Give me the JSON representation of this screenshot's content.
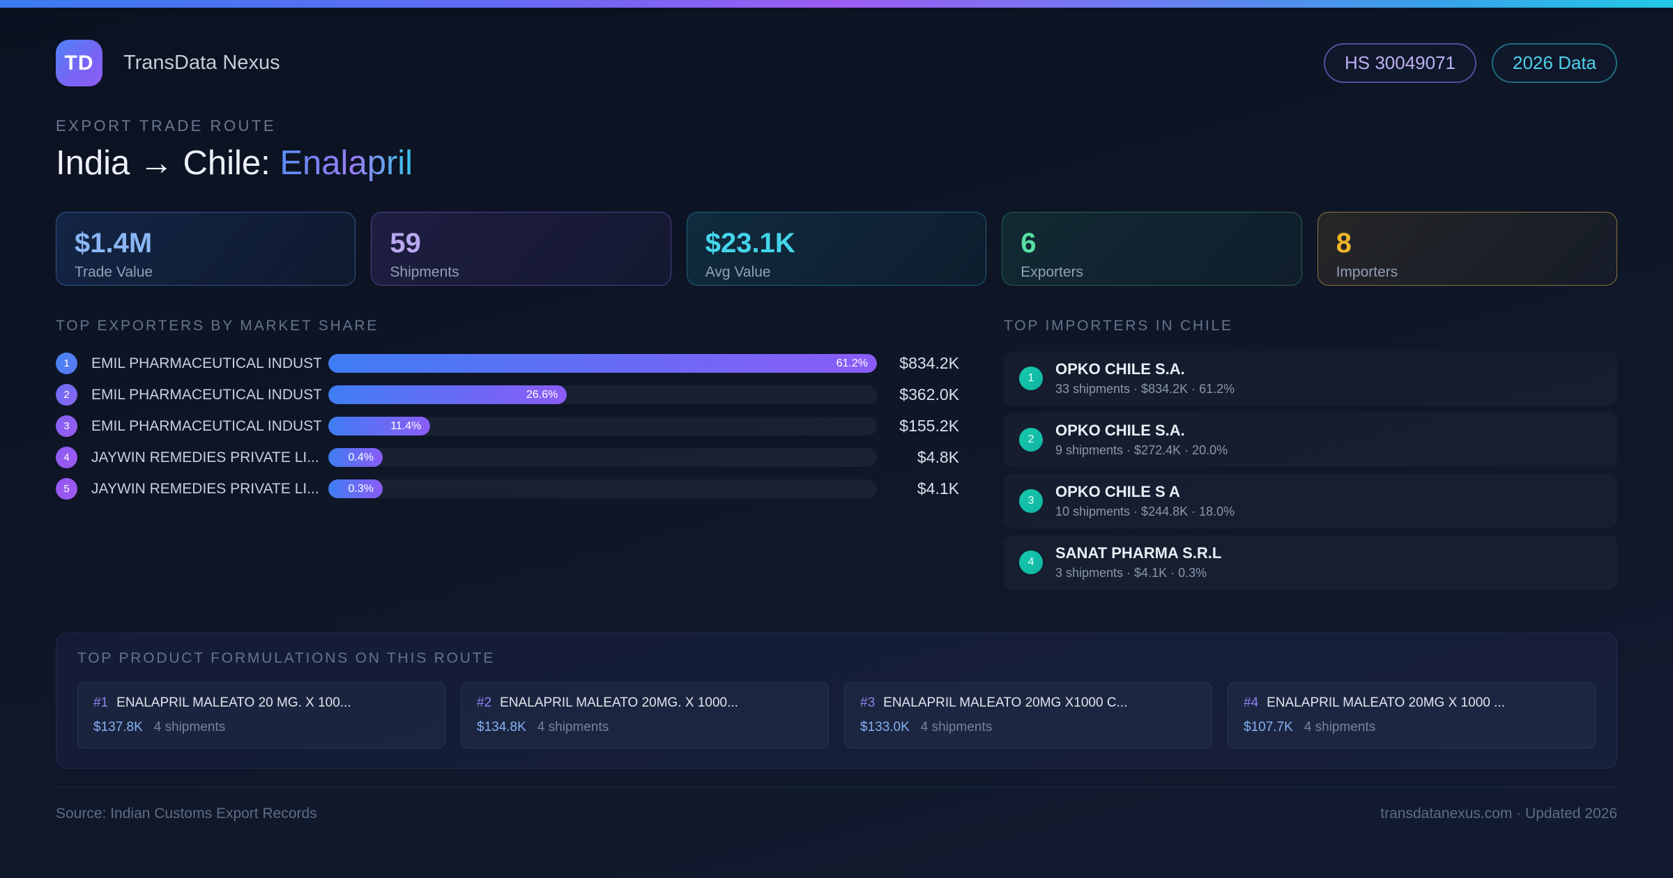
{
  "app": {
    "logo_text": "TD",
    "name": "TransData Nexus",
    "hs_badge": "HS 30049071",
    "year_badge": "2026 Data"
  },
  "header": {
    "eyebrow": "EXPORT TRADE ROUTE",
    "title_route": "India → Chile: ",
    "title_product": "Enalapril"
  },
  "stats": [
    {
      "value": "$1.4M",
      "label": "Trade Value",
      "color": "#8ab6f5"
    },
    {
      "value": "59",
      "label": "Shipments",
      "color": "#b9a7f0"
    },
    {
      "value": "$23.1K",
      "label": "Avg Value",
      "color": "#45d4ec"
    },
    {
      "value": "6",
      "label": "Exporters",
      "color": "#57dfa3"
    },
    {
      "value": "8",
      "label": "Importers",
      "color": "#f0b429"
    }
  ],
  "exporters": {
    "heading": "TOP EXPORTERS BY MARKET SHARE",
    "rows": [
      {
        "rank": "1",
        "name": "EMIL PHARMACEUTICAL INDUST...",
        "share_label": "61.2%",
        "bar_width": "100%",
        "value": "$834.2K"
      },
      {
        "rank": "2",
        "name": "EMIL PHARMACEUTICAL INDUST...",
        "share_label": "26.6%",
        "bar_width": "43.5%",
        "value": "$362.0K"
      },
      {
        "rank": "3",
        "name": "EMIL PHARMACEUTICAL INDUST...",
        "share_label": "11.4%",
        "bar_width": "18.6%",
        "value": "$155.2K"
      },
      {
        "rank": "4",
        "name": "JAYWIN REMEDIES PRIVATE LI...",
        "share_label": "0.4%",
        "bar_width": "0.7%",
        "value": "$4.8K"
      },
      {
        "rank": "5",
        "name": "JAYWIN REMEDIES PRIVATE LI...",
        "share_label": "0.3%",
        "bar_width": "0.5%",
        "value": "$4.1K"
      }
    ]
  },
  "importers": {
    "heading": "TOP IMPORTERS IN CHILE",
    "rows": [
      {
        "rank": "1",
        "name": "OPKO CHILE S.A.",
        "meta": "33 shipments · $834.2K · 61.2%"
      },
      {
        "rank": "2",
        "name": "OPKO CHILE S.A.",
        "meta": "9 shipments · $272.4K · 20.0%"
      },
      {
        "rank": "3",
        "name": "OPKO CHILE S A",
        "meta": "10 shipments · $244.8K · 18.0%"
      },
      {
        "rank": "4",
        "name": "SANAT PHARMA S.R.L",
        "meta": "3 shipments · $4.1K · 0.3%"
      }
    ]
  },
  "products": {
    "heading": "TOP PRODUCT FORMULATIONS ON THIS ROUTE",
    "cards": [
      {
        "rank": "#1",
        "name": "ENALAPRIL MALEATO 20 MG. X 100...",
        "value": "$137.8K",
        "shipments": "4 shipments"
      },
      {
        "rank": "#2",
        "name": "ENALAPRIL MALEATO 20MG. X 1000...",
        "value": "$134.8K",
        "shipments": "4 shipments"
      },
      {
        "rank": "#3",
        "name": "ENALAPRIL MALEATO 20MG X1000 C...",
        "value": "$133.0K",
        "shipments": "4 shipments"
      },
      {
        "rank": "#4",
        "name": "ENALAPRIL MALEATO 20MG X 1000 ...",
        "value": "$107.7K",
        "shipments": "4 shipments"
      }
    ]
  },
  "footer": {
    "source": "Source: Indian Customs Export Records",
    "site": "transdatanexus.com · Updated 2026"
  },
  "colors": {
    "topbar_gradient": [
      "#3b7bf0",
      "#9c5cf2",
      "#22c9e6"
    ],
    "bar_gradient": [
      "#3f7df2",
      "#8b5cf6"
    ],
    "importer_badge": "#14c9ac",
    "accent_blue": "#8ab6f5",
    "accent_purple": "#b9a7f0",
    "accent_cyan": "#45d4ec",
    "accent_green": "#57dfa3",
    "accent_amber": "#f0b429"
  }
}
